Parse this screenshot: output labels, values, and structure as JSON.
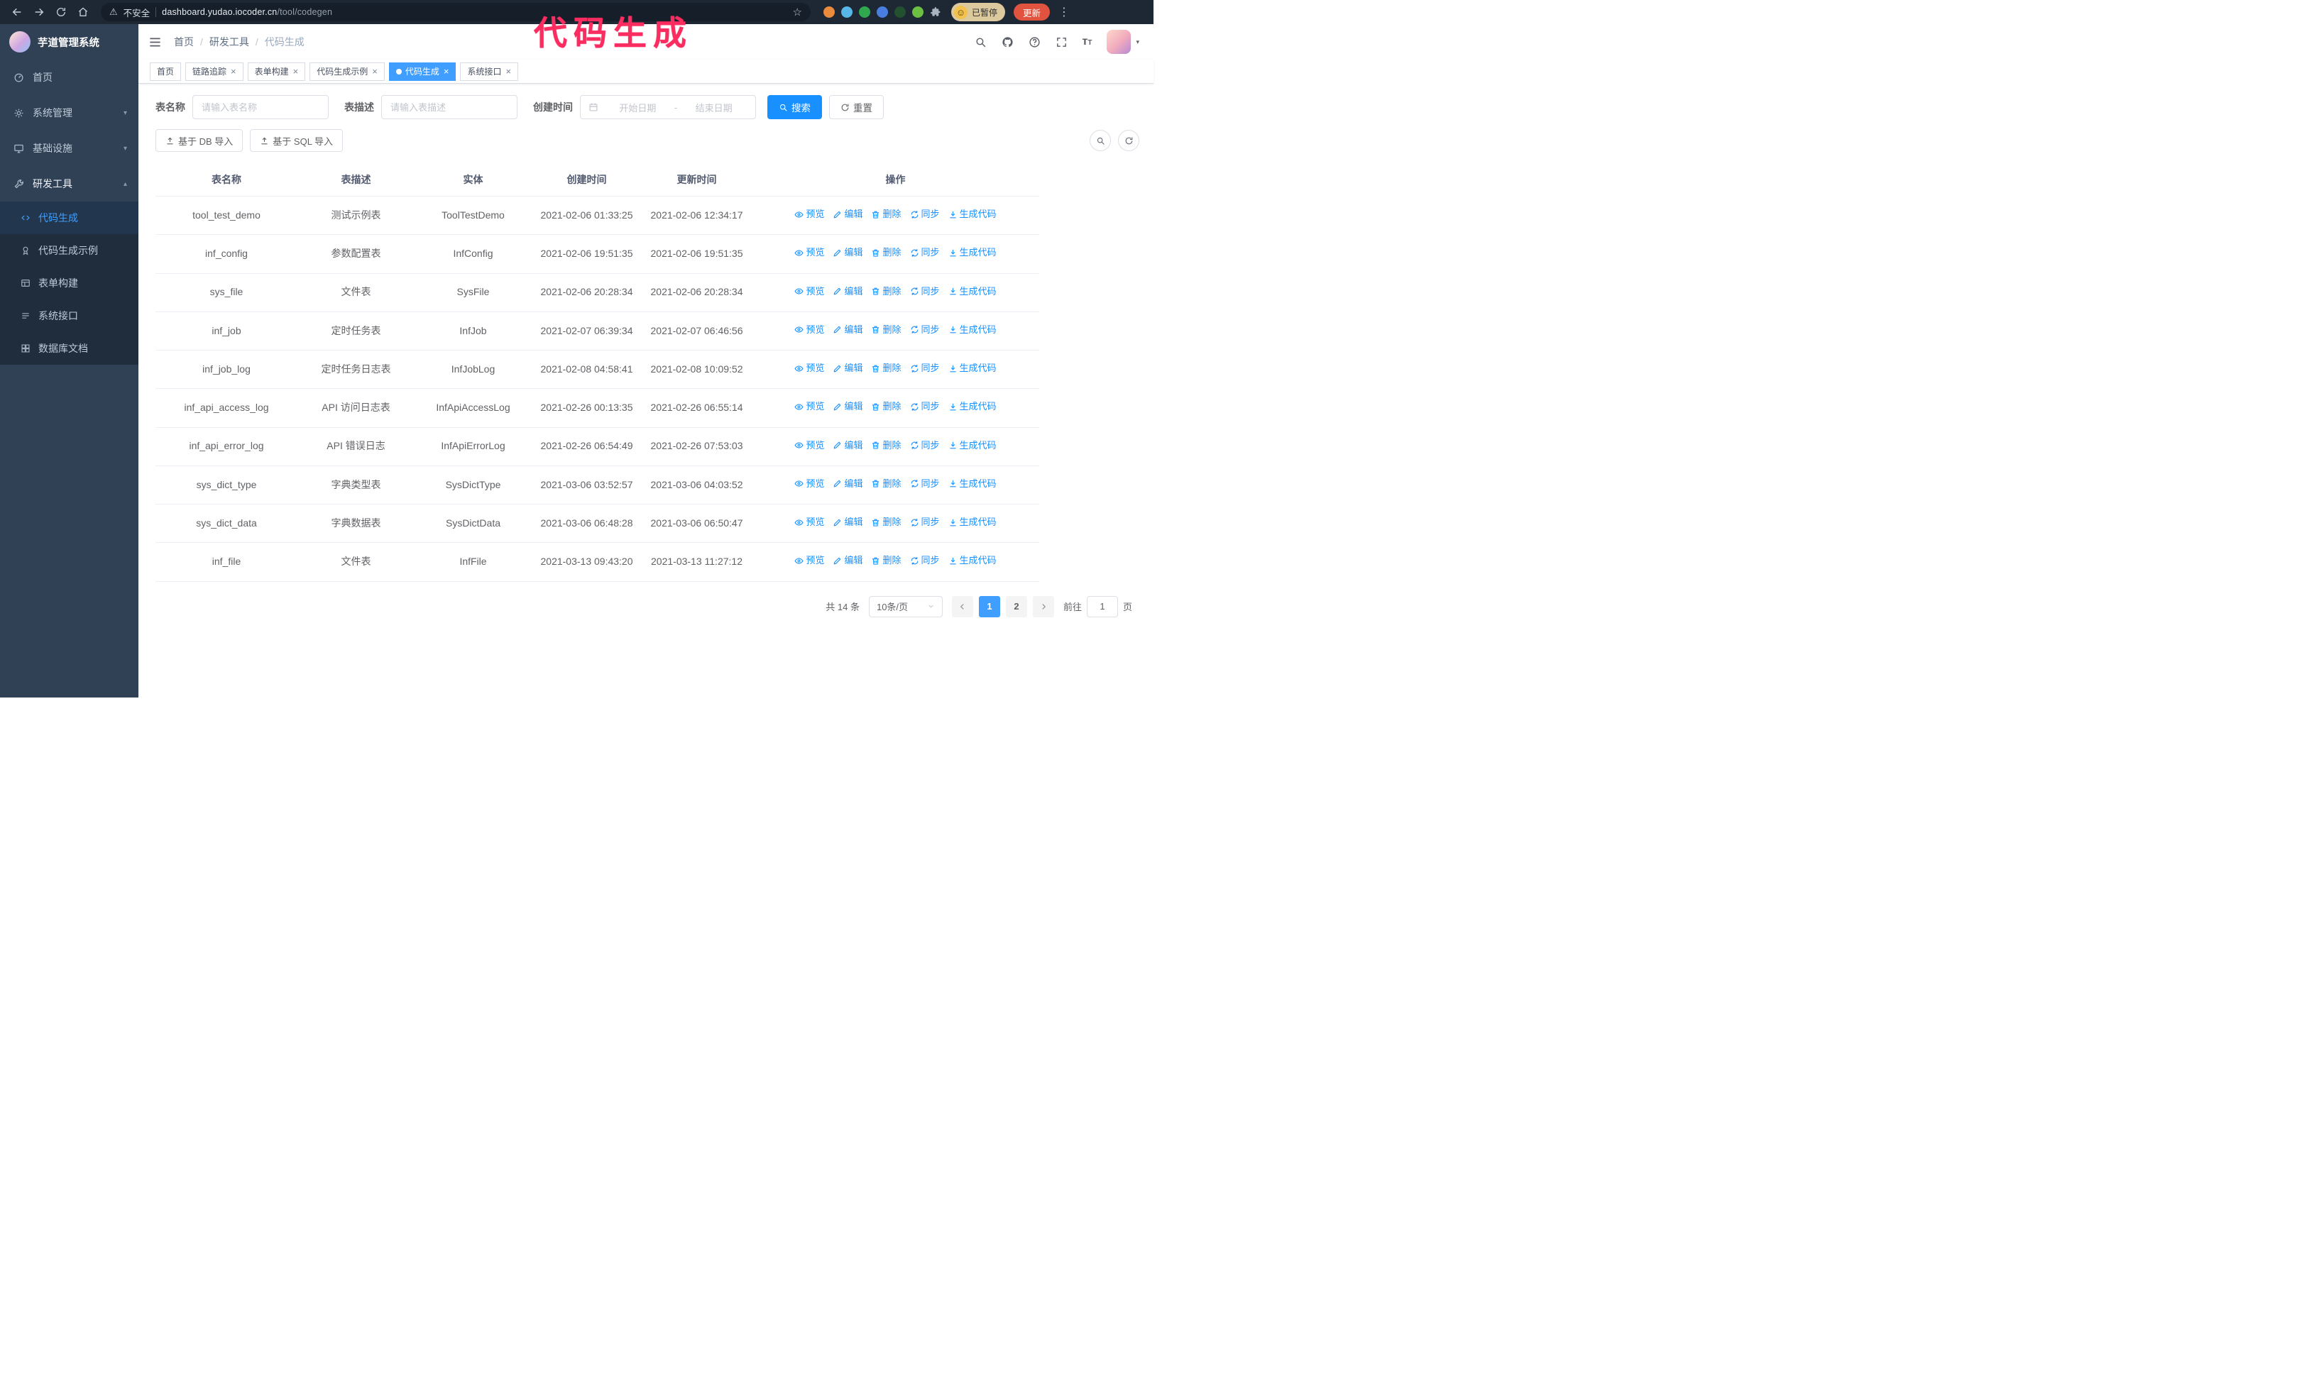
{
  "colors": {
    "accent": "#1890ff",
    "active_tab": "#409eff",
    "annotation": "#fb2c5f",
    "sidebar_bg": "#304156",
    "submenu_bg": "#1f2d3d"
  },
  "browser": {
    "security_warning": "不安全",
    "url_host": "dashboard.yudao.iocoder.cn",
    "url_path": "/tool/codegen",
    "paused_badge": "已暂停",
    "update_button": "更新",
    "extension_colors": [
      "#e98a3c",
      "#58b7e6",
      "#2fa84f",
      "#4a7de0",
      "#23502f",
      "#6cbf43"
    ]
  },
  "annotation": {
    "text": "代码生成"
  },
  "sidebar": {
    "logo_title": "芋道管理系统",
    "items": [
      {
        "key": "home",
        "label": "首页",
        "icon": "dashboard-icon"
      },
      {
        "key": "system",
        "label": "系统管理",
        "icon": "gear-icon",
        "chevron": "down"
      },
      {
        "key": "infra",
        "label": "基础设施",
        "icon": "monitor-icon",
        "chevron": "down"
      },
      {
        "key": "devtools",
        "label": "研发工具",
        "icon": "tool-icon",
        "chevron": "up",
        "expanded": true
      }
    ],
    "submenu": [
      {
        "key": "codegen",
        "label": "代码生成",
        "icon": "code-icon",
        "active": true
      },
      {
        "key": "codegen-example",
        "label": "代码生成示例",
        "icon": "badge-icon"
      },
      {
        "key": "form-builder",
        "label": "表单构建",
        "icon": "form-icon"
      },
      {
        "key": "system-api",
        "label": "系统接口",
        "icon": "api-icon"
      },
      {
        "key": "db-doc",
        "label": "数据库文档",
        "icon": "database-icon"
      }
    ]
  },
  "header": {
    "breadcrumb": [
      "首页",
      "研发工具",
      "代码生成"
    ]
  },
  "tabs": [
    {
      "key": "home",
      "label": "首页",
      "closable": false,
      "active": false
    },
    {
      "key": "tracer",
      "label": "链路追踪",
      "closable": true,
      "active": false
    },
    {
      "key": "form-builder",
      "label": "表单构建",
      "closable": true,
      "active": false
    },
    {
      "key": "codegen-example",
      "label": "代码生成示例",
      "closable": true,
      "active": false
    },
    {
      "key": "codegen",
      "label": "代码生成",
      "closable": true,
      "active": true
    },
    {
      "key": "system-api",
      "label": "系统接口",
      "closable": true,
      "active": false
    }
  ],
  "filters": {
    "table_name_label": "表名称",
    "table_name_placeholder": "请输入表名称",
    "table_desc_label": "表描述",
    "table_desc_placeholder": "请输入表描述",
    "create_time_label": "创建时间",
    "start_date_placeholder": "开始日期",
    "range_separator": "-",
    "end_date_placeholder": "结束日期",
    "search_button": "搜索",
    "reset_button": "重置"
  },
  "toolbar": {
    "import_db_button": "基于 DB 导入",
    "import_sql_button": "基于 SQL 导入"
  },
  "table": {
    "columns": [
      "表名称",
      "表描述",
      "实体",
      "创建时间",
      "更新时间",
      "操作"
    ],
    "actions": [
      {
        "key": "preview",
        "label": "预览",
        "icon": "eye-icon"
      },
      {
        "key": "edit",
        "label": "编辑",
        "icon": "edit-icon"
      },
      {
        "key": "delete",
        "label": "删除",
        "icon": "delete-icon"
      },
      {
        "key": "sync",
        "label": "同步",
        "icon": "sync-icon"
      },
      {
        "key": "generate",
        "label": "生成代码",
        "icon": "download-icon"
      }
    ],
    "rows": [
      {
        "name": "tool_test_demo",
        "desc": "测试示例表",
        "entity": "ToolTestDemo",
        "created": "2021-02-06 01:33:25",
        "updated": "2021-02-06 12:34:17"
      },
      {
        "name": "inf_config",
        "desc": "参数配置表",
        "entity": "InfConfig",
        "created": "2021-02-06 19:51:35",
        "updated": "2021-02-06 19:51:35"
      },
      {
        "name": "sys_file",
        "desc": "文件表",
        "entity": "SysFile",
        "created": "2021-02-06 20:28:34",
        "updated": "2021-02-06 20:28:34"
      },
      {
        "name": "inf_job",
        "desc": "定时任务表",
        "entity": "InfJob",
        "created": "2021-02-07 06:39:34",
        "updated": "2021-02-07 06:46:56"
      },
      {
        "name": "inf_job_log",
        "desc": "定时任务日志表",
        "entity": "InfJobLog",
        "created": "2021-02-08 04:58:41",
        "updated": "2021-02-08 10:09:52"
      },
      {
        "name": "inf_api_access_log",
        "desc": "API 访问日志表",
        "entity": "InfApiAccessLog",
        "created": "2021-02-26 00:13:35",
        "updated": "2021-02-26 06:55:14"
      },
      {
        "name": "inf_api_error_log",
        "desc": "API 错误日志",
        "entity": "InfApiErrorLog",
        "created": "2021-02-26 06:54:49",
        "updated": "2021-02-26 07:53:03"
      },
      {
        "name": "sys_dict_type",
        "desc": "字典类型表",
        "entity": "SysDictType",
        "created": "2021-03-06 03:52:57",
        "updated": "2021-03-06 04:03:52"
      },
      {
        "name": "sys_dict_data",
        "desc": "字典数据表",
        "entity": "SysDictData",
        "created": "2021-03-06 06:48:28",
        "updated": "2021-03-06 06:50:47"
      },
      {
        "name": "inf_file",
        "desc": "文件表",
        "entity": "InfFile",
        "created": "2021-03-13 09:43:20",
        "updated": "2021-03-13 11:27:12"
      }
    ]
  },
  "pagination": {
    "total_text": "共 14 条",
    "page_size": "10条/页",
    "pages": [
      "1",
      "2"
    ],
    "active_page": "1",
    "goto_label": "前往",
    "goto_value": "1",
    "page_unit": "页"
  }
}
